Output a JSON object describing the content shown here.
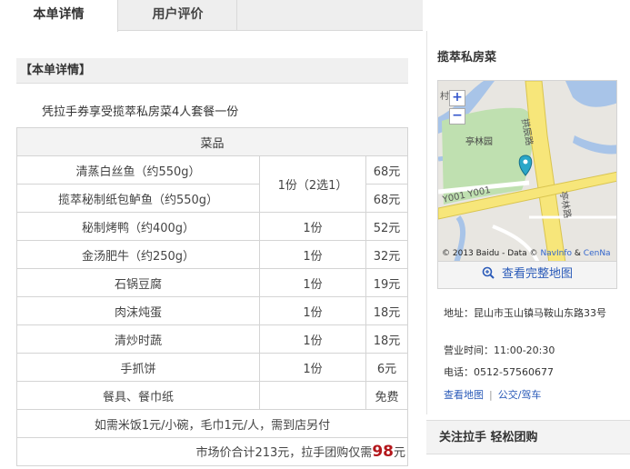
{
  "tabs": [
    {
      "label": "本单详情"
    },
    {
      "label": "用户评价"
    }
  ],
  "section": {
    "title": "【本单详情】",
    "intro": "凭拉手券享受揽萃私房菜4人套餐一份"
  },
  "menu": {
    "header": "菜品",
    "rows": [
      {
        "name": "清蒸白丝鱼（约550g）",
        "price": "68元"
      },
      {
        "name": "揽萃秘制纸包鲈鱼（约550g）",
        "price": "68元"
      },
      {
        "name": "秘制烤鸭（约400g）",
        "qty": "1份",
        "price": "52元"
      },
      {
        "name": "金汤肥牛（约250g）",
        "qty": "1份",
        "price": "32元"
      },
      {
        "name": "石锅豆腐",
        "qty": "1份",
        "price": "19元"
      },
      {
        "name": "肉沫炖蛋",
        "qty": "1份",
        "price": "18元"
      },
      {
        "name": "清炒时蔬",
        "qty": "1份",
        "price": "18元"
      },
      {
        "name": "手抓饼",
        "qty": "1份",
        "price": "6元"
      },
      {
        "name": "餐具、餐巾纸",
        "qty": "",
        "price": "免费"
      }
    ],
    "choice_qty": "1份（2选1）",
    "note": "如需米饭1元/小碗，毛巾1元/人，需到店另付",
    "total_prefix": "市场价合计213元，拉手团购仅需",
    "total_price": "98",
    "total_unit": "元"
  },
  "sidebar": {
    "title": "揽萃私房菜",
    "map": {
      "zoom_in": "+",
      "zoom_out": "−",
      "label_park": "亭林园",
      "label_road1": "拱辰路",
      "label_road2": "亭林路",
      "label_road3": "Y001 Y001",
      "label_cun": "村",
      "copyright_prefix": "© 2013 Baidu - Data ©",
      "copyright_link1": "NavInfo",
      "copyright_amp": " & ",
      "copyright_link2": "CenNa",
      "view_full": "查看完整地图"
    },
    "address_label": "地址：",
    "address": "昆山市玉山镇马鞍山东路33号",
    "hours_label": "营业时间：",
    "hours": "11:00-20:30",
    "phone_label": "电话：",
    "phone": "0512-57560677",
    "link_map": "查看地图",
    "link_route": "公交/驾车",
    "follow": "关注拉手 轻松团购"
  },
  "colors": {
    "accent_price": "#b3161b",
    "link": "#2a5ab8",
    "map_water": "#a8c4e8",
    "map_park": "#bfe0b0",
    "map_road": "#f7e67a",
    "pin": "#2aa7c8"
  }
}
